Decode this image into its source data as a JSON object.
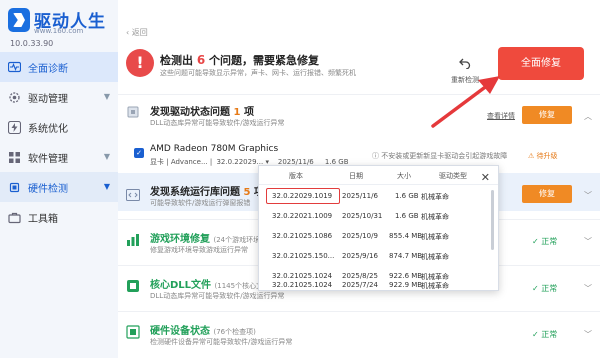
{
  "app": {
    "name": "驱动人生",
    "site": "www.160.com",
    "version": "10.0.33.90"
  },
  "window_controls": {
    "settings_icon": "settings-icon",
    "menu_icon": "menu-icon",
    "minimize_icon": "minimize-icon",
    "close_icon": "close-icon"
  },
  "sidebar": {
    "items": [
      {
        "label": "全面诊断",
        "icon": "pulse-icon",
        "state": "active"
      },
      {
        "label": "驱动管理",
        "icon": "gear-icon",
        "has_arrow": true
      },
      {
        "label": "系统优化",
        "icon": "lightning-icon"
      },
      {
        "label": "软件管理",
        "icon": "grid-icon",
        "has_arrow": true
      },
      {
        "label": "硬件检测",
        "icon": "chip-icon",
        "has_arrow": true,
        "state": "selected"
      },
      {
        "label": "工具箱",
        "icon": "toolbox-icon"
      }
    ]
  },
  "header": {
    "back_label": "返回",
    "alert_prefix": "检测出",
    "alert_count": "6",
    "alert_suffix": "个问题，需要紧急修复",
    "alert_sub": "这些问题可能导致显示异常，声卡、网卡、运行报错、频繁死机",
    "redetect_label": "重新检测",
    "repair_all_label": "全面修复"
  },
  "sections": [
    {
      "title": "发现驱动状态问题",
      "count": "1",
      "count_suffix": "项",
      "desc": "DLL动态库异常可能导致软件/游戏运行异常",
      "view_detail": "查看详情",
      "repair_label": "修复"
    },
    {
      "title": "发现系统运行库问题",
      "count": "5",
      "count_suffix": "项",
      "desc": "可能导致软件/游戏运行弹窗报错",
      "repair_label": "修复"
    },
    {
      "title": "游戏环境修复",
      "count_text": "(24个游戏环境检查)",
      "desc": "修复游戏环境导致游戏运行异常",
      "status": "正常"
    },
    {
      "title": "核心DLL文件",
      "count_text": "(1145个核心文件)",
      "desc": "DLL动态库异常可能导致软件/游戏运行异常",
      "status": "正常"
    },
    {
      "title": "硬件设备状态",
      "count_text": "(76个检查项)",
      "desc": "检测硬件设备异常可能导致软件/游戏运行异常",
      "status": "正常"
    }
  ],
  "driver": {
    "name": "AMD Radeon 780M Graphics",
    "category": "显卡",
    "type": "Advance...",
    "selected_version": "32.0.22029...",
    "date": "2025/11/6",
    "size": "1.6 GB",
    "note": "不安装或更新新显卡驱动会引起游戏故障",
    "status": "待升级"
  },
  "version_popup": {
    "headers": [
      "版本",
      "日期",
      "大小",
      "驱动类型"
    ],
    "rows": [
      {
        "version": "32.0.22029.1019",
        "date": "2025/11/6",
        "size": "1.6 GB",
        "type": "机械革命"
      },
      {
        "version": "32.0.22021.1009",
        "date": "2025/10/31",
        "size": "1.6 GB",
        "type": "机械革命"
      },
      {
        "version": "32.0.21025.1086",
        "date": "2025/10/9",
        "size": "855.4 MB",
        "type": "机械革命"
      },
      {
        "version": "32.0.21025.150...",
        "date": "2025/9/16",
        "size": "874.7 MB",
        "type": "机械革命"
      },
      {
        "version": "32.0.21025.1024",
        "date": "2025/8/25",
        "size": "922.6 MB",
        "type": "机械革命"
      },
      {
        "version": "32.0.21025.1024",
        "date": "2025/7/24",
        "size": "922.9 MB",
        "type": "机械革命"
      }
    ]
  },
  "colors": {
    "brand_blue": "#1a5fd0",
    "danger_red": "#ef4a3d",
    "warn_orange": "#f08a24",
    "ok_green": "#22a05a"
  }
}
